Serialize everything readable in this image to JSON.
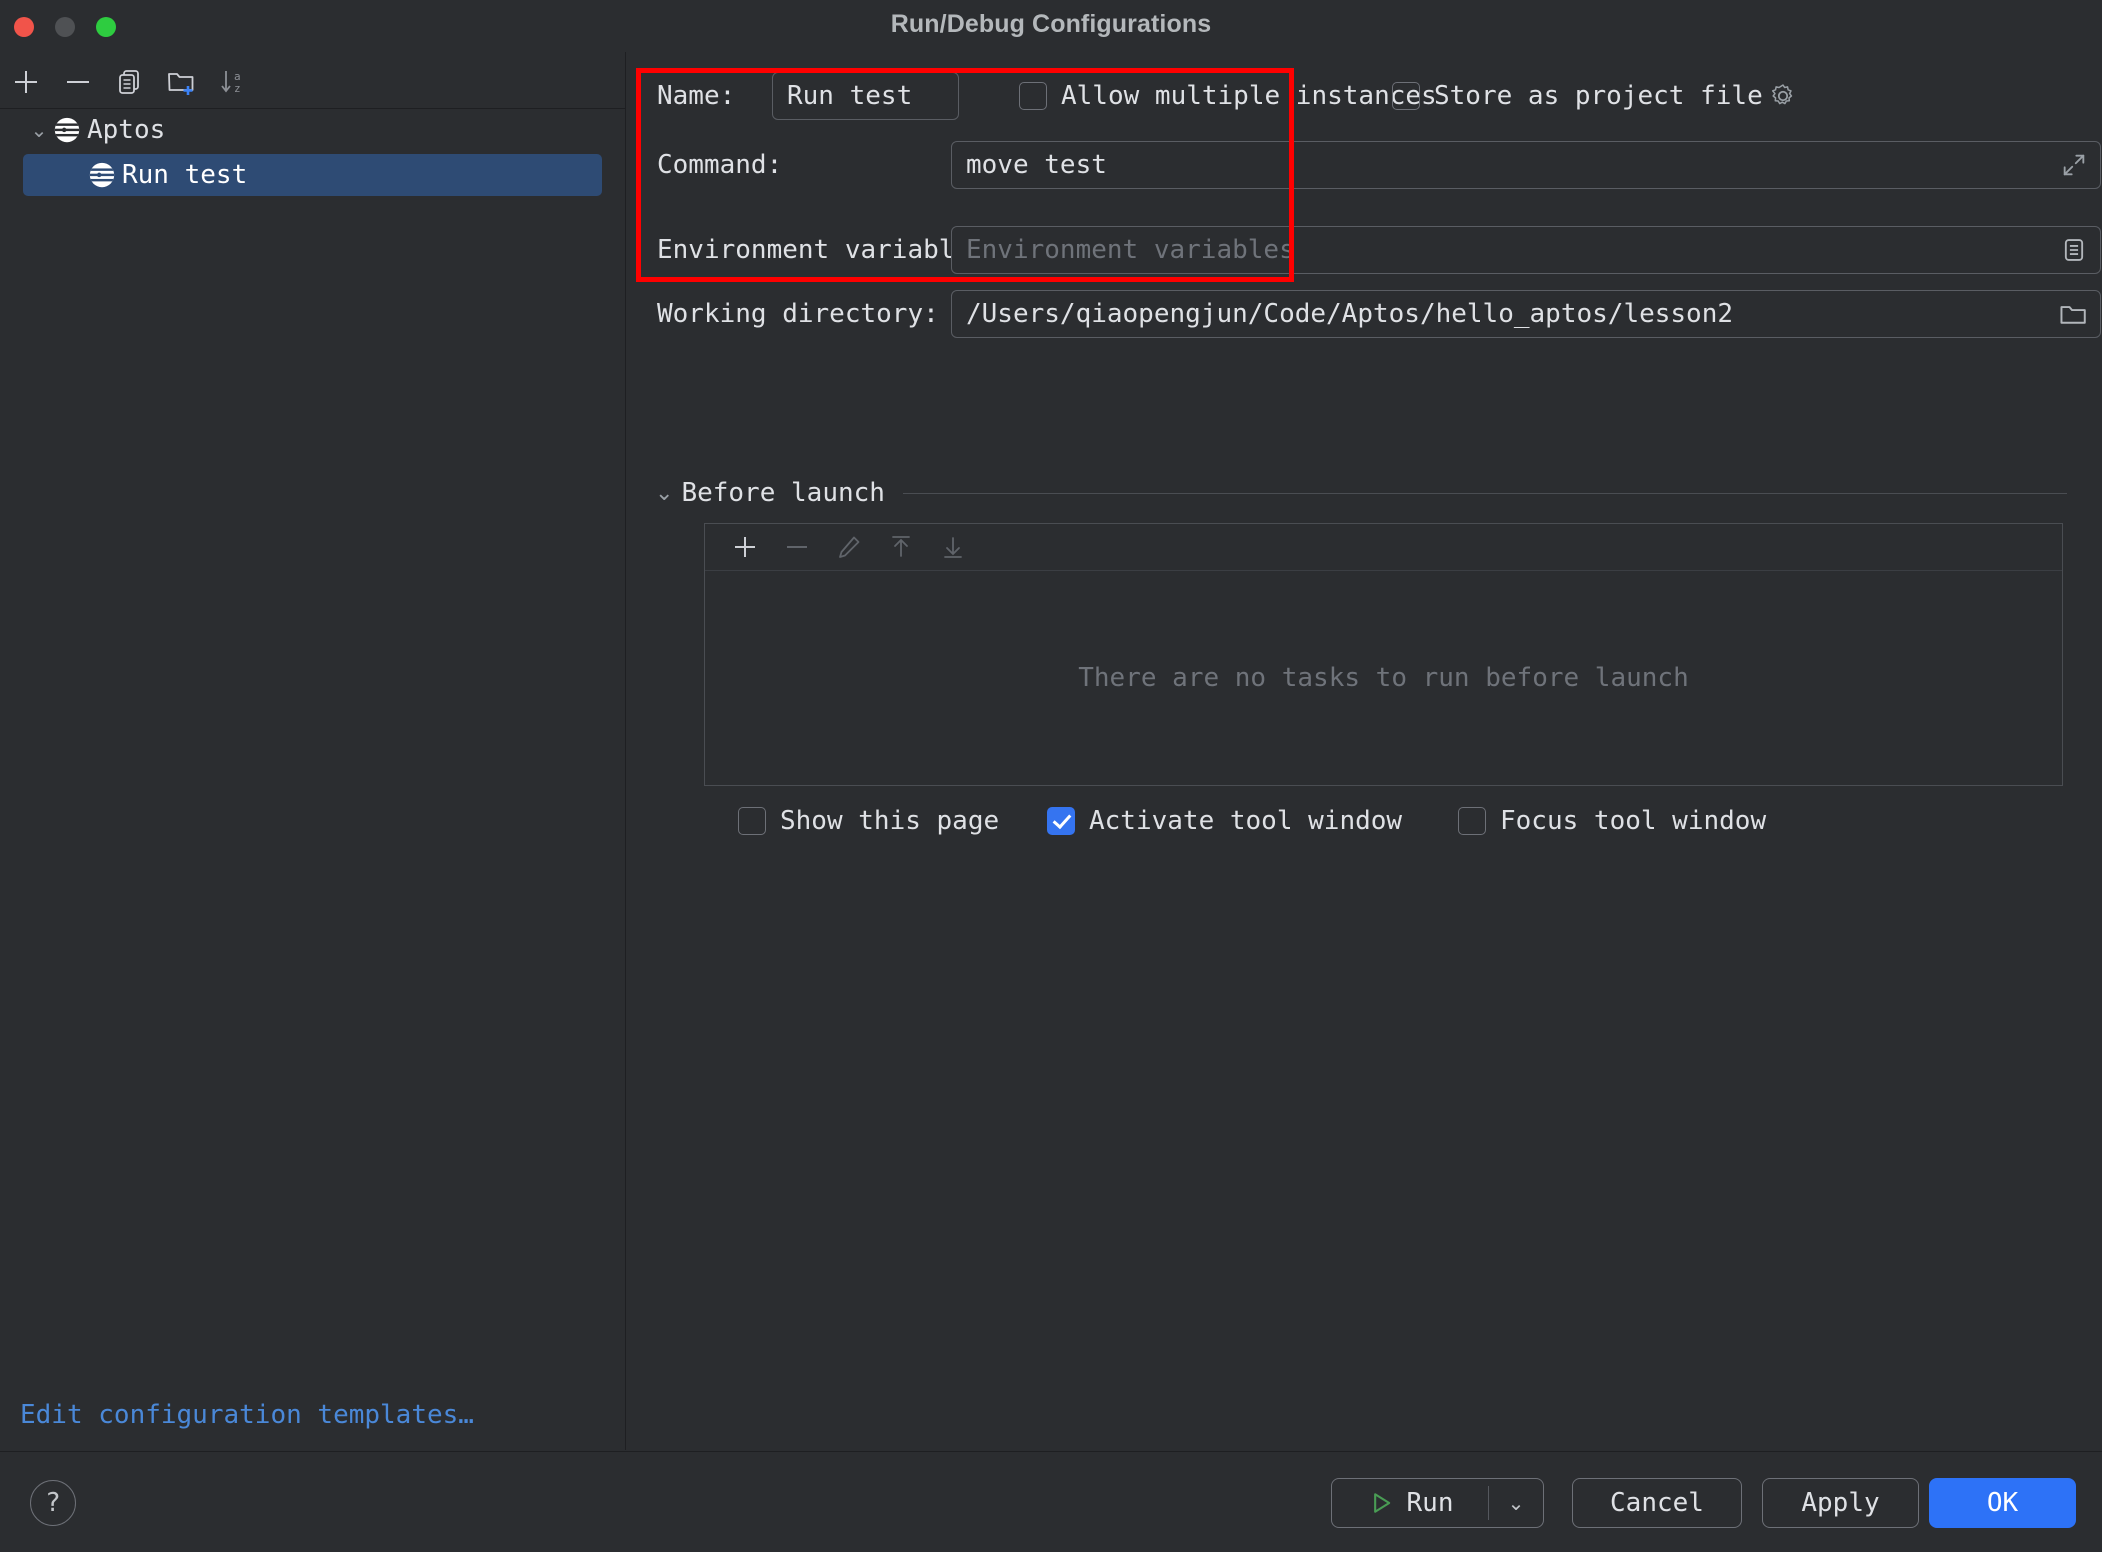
{
  "window": {
    "title": "Run/Debug Configurations",
    "traffic_lights": [
      "close",
      "minimize",
      "maximize"
    ]
  },
  "sidebar": {
    "toolbar": [
      {
        "name": "add-configuration-button",
        "icon": "plus-icon"
      },
      {
        "name": "remove-configuration-button",
        "icon": "minus-icon"
      },
      {
        "name": "copy-configuration-button",
        "icon": "copy-icon"
      },
      {
        "name": "new-folder-button",
        "icon": "folder-add-icon"
      },
      {
        "name": "sort-configurations-button",
        "icon": "sort-az-icon"
      }
    ],
    "tree": [
      {
        "label": "Aptos",
        "icon": "aptos-logo-icon",
        "expanded": true,
        "selected": false,
        "level": 0
      },
      {
        "label": "Run test",
        "icon": "aptos-logo-icon",
        "expanded": false,
        "selected": true,
        "level": 1
      }
    ],
    "edit_templates_link": "Edit configuration templates…"
  },
  "form": {
    "name_label": "Name:",
    "name_value": "Run test",
    "allow_multiple_label": "Allow multiple instances",
    "allow_multiple_checked": false,
    "store_as_project_file_label": "Store as project file",
    "store_as_project_file_checked": false,
    "store_gear_icon": "gear-icon",
    "command_label": "Command:",
    "command_value": "move test",
    "command_expand_icon": "expand-icon",
    "env_label": "Environment variables:",
    "env_value": "",
    "env_placeholder": "Environment variables",
    "env_browse_icon": "list-icon",
    "workdir_label": "Working directory:",
    "workdir_value": "/Users/qiaopengjun/Code/Aptos/hello_aptos/lesson2",
    "workdir_browse_icon": "folder-icon"
  },
  "before_launch": {
    "section_title": "Before launch",
    "collapse_icon": "chevron-down-icon",
    "toolbar": [
      {
        "name": "add-task-button",
        "icon": "plus-icon",
        "enabled": true
      },
      {
        "name": "remove-task-button",
        "icon": "minus-icon",
        "enabled": false
      },
      {
        "name": "edit-task-button",
        "icon": "pencil-icon",
        "enabled": false
      },
      {
        "name": "move-task-up-button",
        "icon": "arrow-up-icon",
        "enabled": false
      },
      {
        "name": "move-task-down-button",
        "icon": "arrow-down-icon",
        "enabled": false
      }
    ],
    "empty_text": "There are no tasks to run before launch",
    "options": [
      {
        "label": "Show this page",
        "checked": false
      },
      {
        "label": "Activate tool window",
        "checked": true
      },
      {
        "label": "Focus tool window",
        "checked": false
      }
    ]
  },
  "footer": {
    "help_label": "?",
    "run_label": "Run",
    "run_icon": "play-icon",
    "run_dropdown_icon": "chevron-down-icon",
    "cancel_label": "Cancel",
    "apply_label": "Apply",
    "ok_label": "OK"
  },
  "colors": {
    "background": "#2b2d30",
    "selection": "#2e4b74",
    "accent_blue": "#3574f0",
    "ok_button": "#2d72f7",
    "link_blue": "#4a88d8",
    "annotation_red": "#ff0000",
    "run_green": "#499c54",
    "text": "#dfe1e5",
    "muted_text": "#6f737a"
  },
  "annotation": {
    "shape": "rectangle",
    "color": "#ff0000",
    "covers": "Name and Command fields"
  }
}
